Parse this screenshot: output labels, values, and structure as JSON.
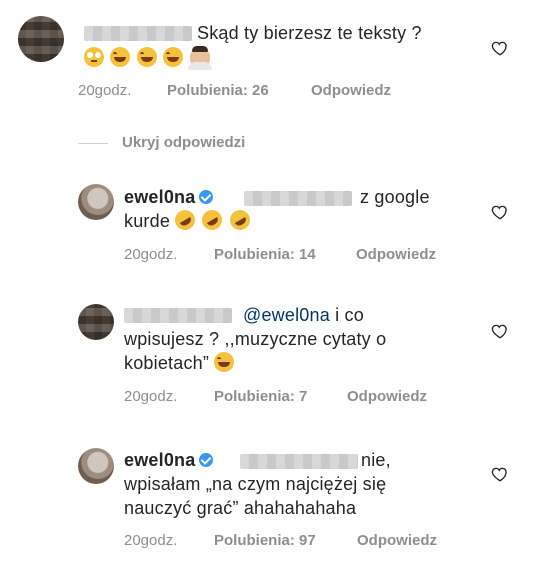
{
  "comments": [
    {
      "text": "Skąd ty bierzesz te teksty ?",
      "emojis": [
        "face-with-rolling-eyes",
        "tears-of-joy",
        "tears-of-joy",
        "tears-of-joy",
        "man-facepalming"
      ],
      "time": "20godz.",
      "likes": "Polubienia: 26",
      "reply": "Odpowiedz"
    },
    {
      "username": "ewel0na",
      "line1_suffix": "z google",
      "line2": "kurde",
      "emojis": [
        "rolling-on-the-floor-laughing",
        "rolling-on-the-floor-laughing",
        "rolling-on-the-floor-laughing"
      ],
      "time": "20godz.",
      "likes": "Polubienia: 14",
      "reply": "Odpowiedz"
    },
    {
      "mention": "@ewel0na",
      "line1_suffix": "i co",
      "line2": "wpisujesz ? ,,muzyczne cytaty o",
      "line3": "kobietach”",
      "emojis": [
        "tears-of-joy"
      ],
      "time": "20godz.",
      "likes": "Polubienia: 7",
      "reply": "Odpowiedz"
    },
    {
      "username": "ewel0na",
      "line1_suffix": "nie,",
      "line2": "wpisałam „na czym najciężej się",
      "line3": "nauczyć grać” ahahahahaha",
      "time": "20godz.",
      "likes": "Polubienia: 97",
      "reply": "Odpowiedz"
    }
  ],
  "hide_replies": "Ukryj odpowiedzi",
  "colors": {
    "meta": "#8e8e8e",
    "text": "#262626",
    "verified": "#3897f0",
    "mention": "#00376b"
  }
}
